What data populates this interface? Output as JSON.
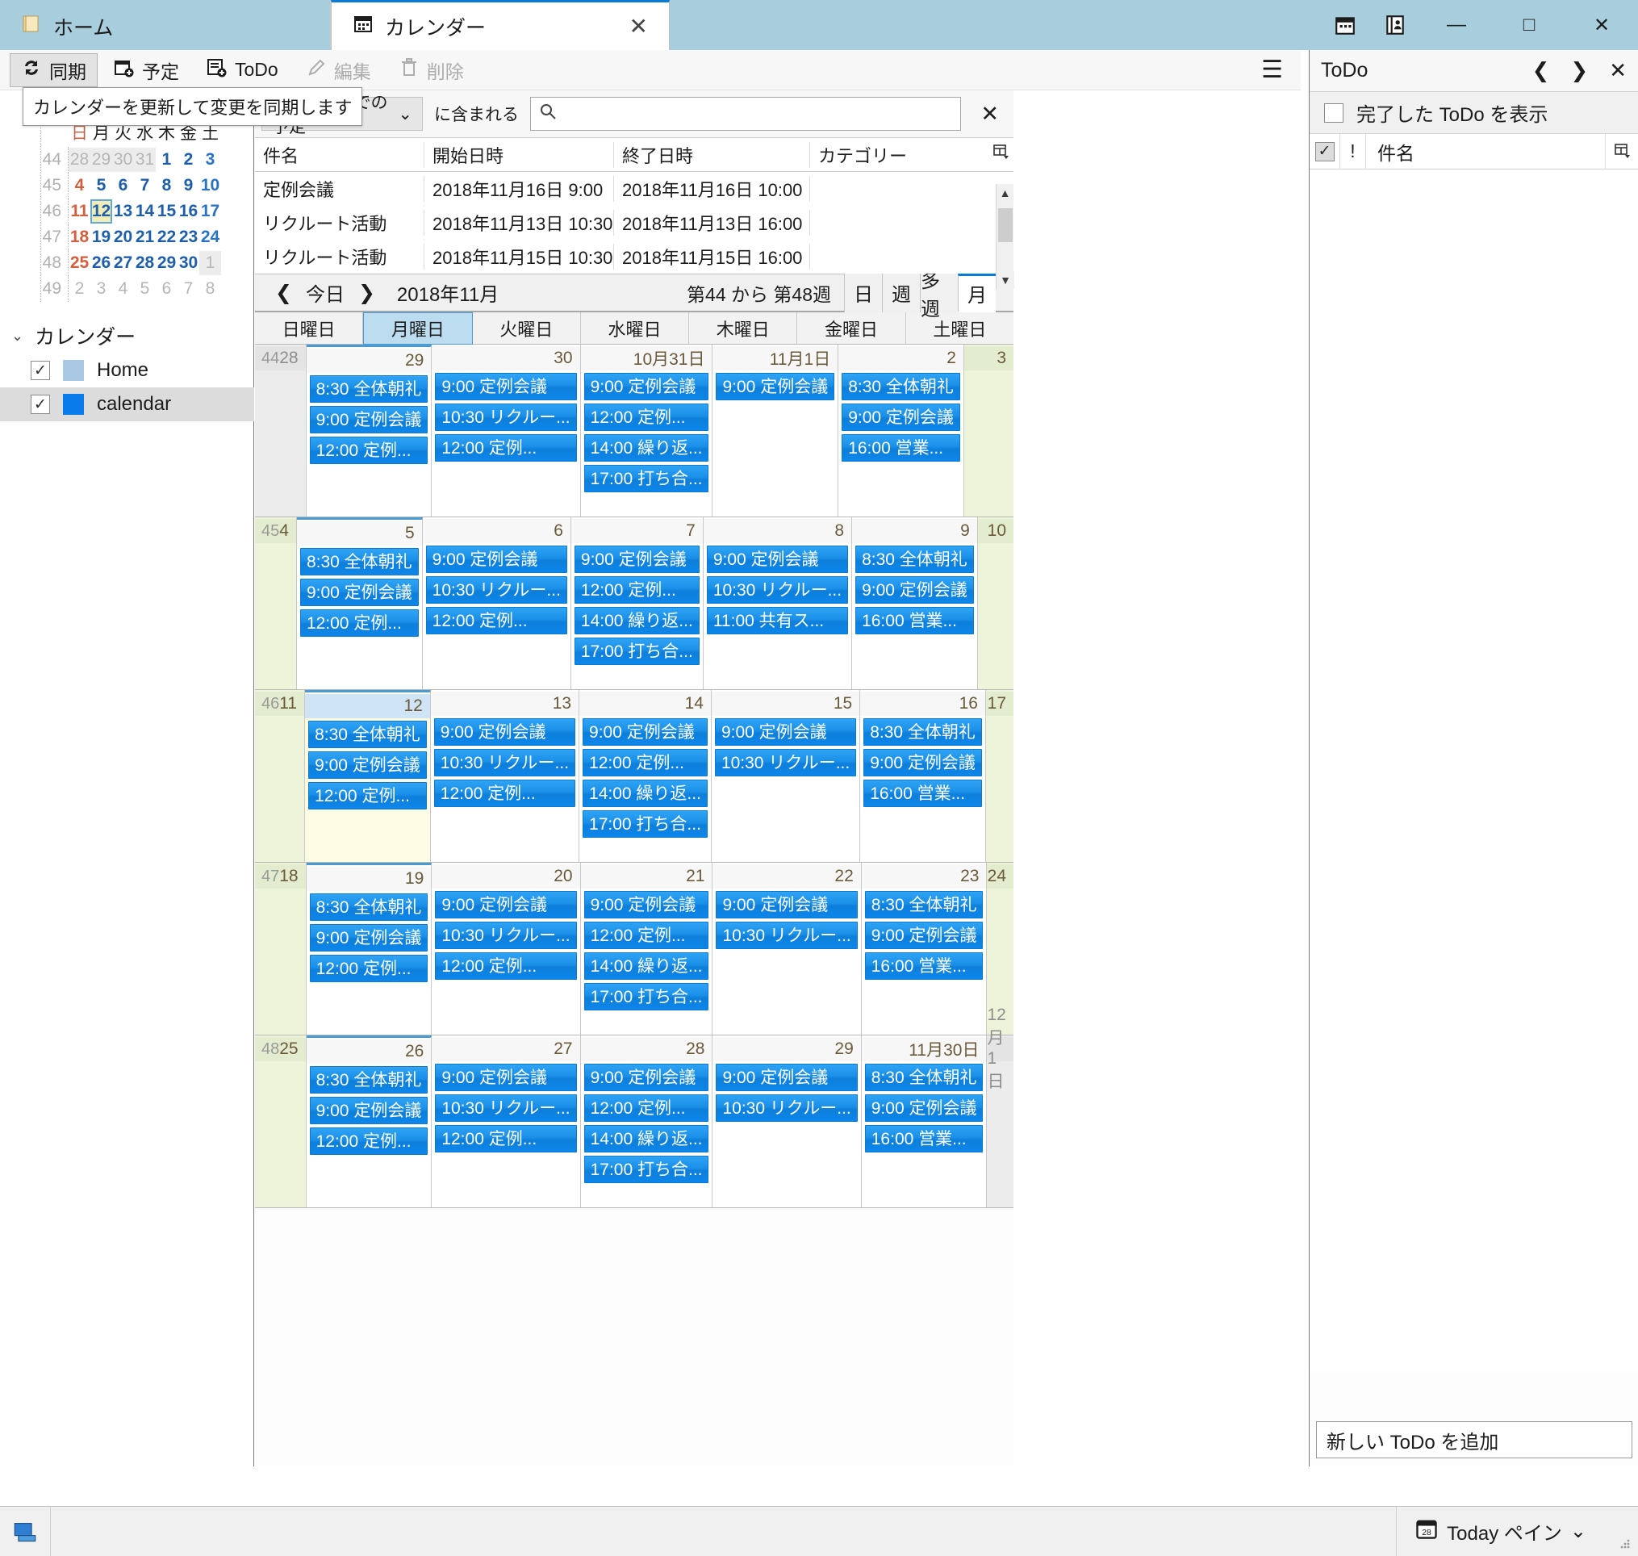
{
  "window": {
    "tabs": [
      {
        "label": "ホーム",
        "icon": "folder-icon",
        "active": false
      },
      {
        "label": "カレンダー",
        "icon": "calendar-icon",
        "active": true
      }
    ],
    "tab_close": "✕",
    "title_icons": [
      "calendar-icon",
      "address-book-icon"
    ],
    "controls": {
      "minimize": "—",
      "maximize": "□",
      "close": "✕"
    }
  },
  "toolbar": {
    "sync": "同期",
    "appointment": "予定",
    "todo": "ToDo",
    "edit": "編集",
    "delete": "削除",
    "menu": "☰",
    "tooltip": "カレンダーを更新して変更を同期します"
  },
  "mini_calendar": {
    "dow": [
      "日",
      "月",
      "火",
      "水",
      "木",
      "金",
      "土"
    ],
    "weeks": [
      {
        "num": "44",
        "days": [
          "28",
          "29",
          "30",
          "31",
          "1",
          "2",
          "3"
        ],
        "types": [
          "other",
          "other",
          "other",
          "other",
          "cur",
          "cur",
          "sat"
        ]
      },
      {
        "num": "45",
        "days": [
          "4",
          "5",
          "6",
          "7",
          "8",
          "9",
          "10"
        ],
        "types": [
          "sun",
          "cur",
          "cur",
          "cur",
          "cur",
          "cur",
          "sat"
        ]
      },
      {
        "num": "46",
        "days": [
          "11",
          "12",
          "13",
          "14",
          "15",
          "16",
          "17"
        ],
        "types": [
          "sun",
          "today",
          "cur",
          "cur",
          "cur",
          "cur",
          "sat"
        ]
      },
      {
        "num": "47",
        "days": [
          "18",
          "19",
          "20",
          "21",
          "22",
          "23",
          "24"
        ],
        "types": [
          "sun",
          "cur",
          "cur",
          "cur",
          "cur",
          "cur",
          "sat"
        ]
      },
      {
        "num": "48",
        "days": [
          "25",
          "26",
          "27",
          "28",
          "29",
          "30",
          "1"
        ],
        "types": [
          "sun",
          "cur",
          "cur",
          "cur",
          "cur",
          "cur",
          "other"
        ]
      },
      {
        "num": "49",
        "days": [
          "2",
          "3",
          "4",
          "5",
          "6",
          "7",
          "8"
        ],
        "types": [
          "other",
          "other",
          "other",
          "other",
          "other",
          "other",
          "other"
        ]
      }
    ]
  },
  "tree": {
    "root": "カレンダー",
    "items": [
      {
        "label": "Home",
        "checked": true,
        "color": "#a8c8e4",
        "selected": false
      },
      {
        "label": "calendar",
        "checked": true,
        "color": "#0a7bea",
        "selected": true
      }
    ]
  },
  "filterbar": {
    "range": "1 週間後までの予定",
    "contains": "に含まれる",
    "search_value": "",
    "search_placeholder": "",
    "clear": "✕"
  },
  "event_list": {
    "columns": [
      "件名",
      "開始日時",
      "終了日時",
      "カテゴリー"
    ],
    "rows": [
      {
        "name": "定例会議",
        "start": "2018年11月16日 9:00",
        "end": "2018年11月16日 10:00",
        "category": ""
      },
      {
        "name": "リクルート活動",
        "start": "2018年11月13日 10:30",
        "end": "2018年11月13日 16:00",
        "category": ""
      },
      {
        "name": "リクルート活動",
        "start": "2018年11月15日 10:30",
        "end": "2018年11月15日 16:00",
        "category": ""
      }
    ]
  },
  "calendar_nav": {
    "prev": "❮",
    "today": "今日",
    "next": "❯",
    "period": "2018年11月",
    "week_range": "第44 から 第48週",
    "views": [
      {
        "label": "日",
        "active": false
      },
      {
        "label": "週",
        "active": false
      },
      {
        "label": "多週",
        "active": false
      },
      {
        "label": "月",
        "active": true
      }
    ]
  },
  "calendar_grid": {
    "dow_headers": [
      {
        "label": "日曜日",
        "selected": false
      },
      {
        "label": "月曜日",
        "selected": true
      },
      {
        "label": "火曜日",
        "selected": false
      },
      {
        "label": "水曜日",
        "selected": false
      },
      {
        "label": "木曜日",
        "selected": false
      },
      {
        "label": "金曜日",
        "selected": false
      },
      {
        "label": "土曜日",
        "selected": false
      }
    ],
    "weeks": [
      {
        "week": "44",
        "days": [
          {
            "num": "28",
            "style": "other",
            "events": []
          },
          {
            "num": "29",
            "style": "selcol",
            "events": [
              "8:30 全体朝礼",
              "9:00 定例会議",
              "12:00 定例..."
            ]
          },
          {
            "num": "30",
            "style": "normal",
            "events": [
              "9:00 定例会議",
              "10:30 リクルー...",
              "12:00 定例..."
            ]
          },
          {
            "num": "10月31日",
            "style": "normal",
            "events": [
              "9:00 定例会議",
              "12:00 定例...",
              "14:00 繰り返...",
              "17:00 打ち合..."
            ]
          },
          {
            "num": "11月1日",
            "style": "normal",
            "events": [
              "9:00 定例会議"
            ]
          },
          {
            "num": "2",
            "style": "normal",
            "events": [
              "8:30 全体朝礼",
              "9:00 定例会議",
              "16:00 営業..."
            ]
          },
          {
            "num": "3",
            "style": "weekend",
            "events": []
          }
        ]
      },
      {
        "week": "45",
        "days": [
          {
            "num": "4",
            "style": "weekend",
            "events": []
          },
          {
            "num": "5",
            "style": "selcol",
            "events": [
              "8:30 全体朝礼",
              "9:00 定例会議",
              "12:00 定例..."
            ]
          },
          {
            "num": "6",
            "style": "normal",
            "events": [
              "9:00 定例会議",
              "10:30 リクルー...",
              "12:00 定例..."
            ]
          },
          {
            "num": "7",
            "style": "normal",
            "events": [
              "9:00 定例会議",
              "12:00 定例...",
              "14:00 繰り返...",
              "17:00 打ち合..."
            ]
          },
          {
            "num": "8",
            "style": "normal",
            "events": [
              "9:00 定例会議",
              "10:30 リクルー...",
              "11:00 共有ス..."
            ]
          },
          {
            "num": "9",
            "style": "normal",
            "events": [
              "8:30 全体朝礼",
              "9:00 定例会議",
              "16:00 営業..."
            ]
          },
          {
            "num": "10",
            "style": "weekend",
            "events": []
          }
        ]
      },
      {
        "week": "46",
        "days": [
          {
            "num": "11",
            "style": "weekend",
            "events": []
          },
          {
            "num": "12",
            "style": "today",
            "events": [
              "8:30 全体朝礼",
              "9:00 定例会議",
              "12:00 定例..."
            ]
          },
          {
            "num": "13",
            "style": "normal",
            "events": [
              "9:00 定例会議",
              "10:30 リクルー...",
              "12:00 定例..."
            ]
          },
          {
            "num": "14",
            "style": "normal",
            "events": [
              "9:00 定例会議",
              "12:00 定例...",
              "14:00 繰り返...",
              "17:00 打ち合..."
            ]
          },
          {
            "num": "15",
            "style": "normal",
            "events": [
              "9:00 定例会議",
              "10:30 リクルー..."
            ]
          },
          {
            "num": "16",
            "style": "normal",
            "events": [
              "8:30 全体朝礼",
              "9:00 定例会議",
              "16:00 営業..."
            ]
          },
          {
            "num": "17",
            "style": "weekend",
            "events": []
          }
        ]
      },
      {
        "week": "47",
        "days": [
          {
            "num": "18",
            "style": "weekend",
            "events": []
          },
          {
            "num": "19",
            "style": "selcol",
            "events": [
              "8:30 全体朝礼",
              "9:00 定例会議",
              "12:00 定例..."
            ]
          },
          {
            "num": "20",
            "style": "normal",
            "events": [
              "9:00 定例会議",
              "10:30 リクルー...",
              "12:00 定例..."
            ]
          },
          {
            "num": "21",
            "style": "normal",
            "events": [
              "9:00 定例会議",
              "12:00 定例...",
              "14:00 繰り返...",
              "17:00 打ち合..."
            ]
          },
          {
            "num": "22",
            "style": "normal",
            "events": [
              "9:00 定例会議",
              "10:30 リクルー..."
            ]
          },
          {
            "num": "23",
            "style": "normal",
            "events": [
              "8:30 全体朝礼",
              "9:00 定例会議",
              "16:00 営業..."
            ]
          },
          {
            "num": "24",
            "style": "weekend",
            "events": []
          }
        ]
      },
      {
        "week": "48",
        "days": [
          {
            "num": "25",
            "style": "weekend",
            "events": []
          },
          {
            "num": "26",
            "style": "selcol",
            "events": [
              "8:30 全体朝礼",
              "9:00 定例会議",
              "12:00 定例..."
            ]
          },
          {
            "num": "27",
            "style": "normal",
            "events": [
              "9:00 定例会議",
              "10:30 リクルー...",
              "12:00 定例..."
            ]
          },
          {
            "num": "28",
            "style": "normal",
            "events": [
              "9:00 定例会議",
              "12:00 定例...",
              "14:00 繰り返...",
              "17:00 打ち合..."
            ]
          },
          {
            "num": "29",
            "style": "normal",
            "events": [
              "9:00 定例会議",
              "10:30 リクルー..."
            ]
          },
          {
            "num": "11月30日",
            "style": "normal",
            "events": [
              "8:30 全体朝礼",
              "9:00 定例会議",
              "16:00 営業..."
            ]
          },
          {
            "num": "12月1日",
            "style": "other",
            "events": []
          }
        ]
      }
    ]
  },
  "todo_pane": {
    "title": "ToDo",
    "prev": "❮",
    "next": "❯",
    "close": "✕",
    "show_completed": "完了した ToDo を表示",
    "show_completed_checked": false,
    "columns": [
      "✓",
      "!",
      "件名"
    ],
    "rows": [],
    "add_placeholder": "新しい ToDo を追加"
  },
  "statusbar": {
    "today_pane": "Today ペイン",
    "dropdown": "⌄"
  }
}
